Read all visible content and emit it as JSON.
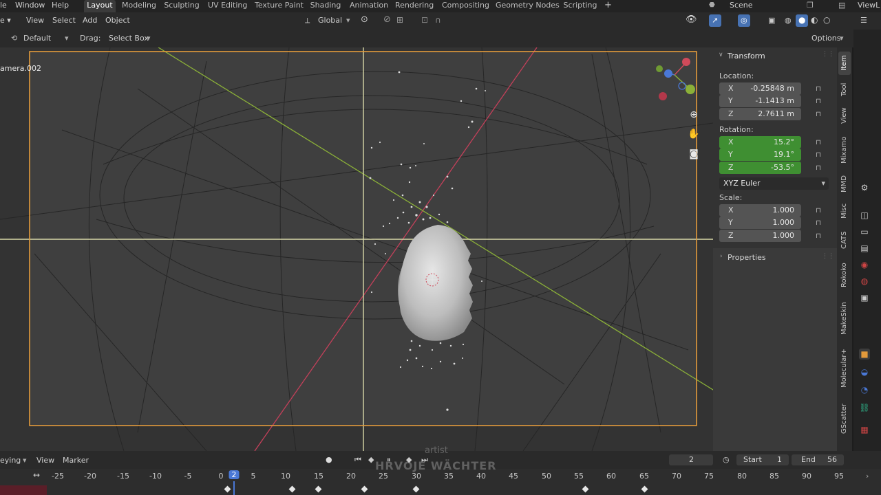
{
  "menu": {
    "file_partial": "le",
    "window": "Window",
    "help": "Help"
  },
  "workspaces": [
    "Layout",
    "Modeling",
    "Sculpting",
    "UV Editing",
    "Texture Paint",
    "Shading",
    "Animation",
    "Rendering",
    "Compositing",
    "Geometry Nodes",
    "Scripting"
  ],
  "top_right": {
    "scene": "Scene",
    "view_layer": "ViewL"
  },
  "header": {
    "view": "View",
    "select": "Select",
    "add": "Add",
    "object": "Object",
    "orientation": "Global",
    "transform_orientation_label": "Default",
    "drag_label": "Drag:",
    "drag_value": "Select Box",
    "options": "Options"
  },
  "viewport": {
    "camera_label": "amera.002"
  },
  "transform": {
    "title": "Transform",
    "location_label": "Location:",
    "location": {
      "x": "-0.25848 m",
      "y": "-1.1413 m",
      "z": "2.7611 m"
    },
    "rotation_label": "Rotation:",
    "rotation": {
      "x": "15.2°",
      "y": "19.1°",
      "z": "-53.5°"
    },
    "rotation_mode": "XYZ Euler",
    "scale_label": "Scale:",
    "scale": {
      "x": "1.000",
      "y": "1.000",
      "z": "1.000"
    },
    "axis_x": "X",
    "axis_y": "Y",
    "axis_z": "Z"
  },
  "properties_panel": {
    "title": "Properties"
  },
  "side_tabs": [
    "Item",
    "Tool",
    "View",
    "Mixamo",
    "MMD",
    "Misc",
    "CATS",
    "Rokoko",
    "MakeSkin",
    "Molecular+",
    "GScatter"
  ],
  "timeline": {
    "keying": "eying",
    "view": "View",
    "marker": "Marker",
    "current_frame": "2",
    "start_label": "Start",
    "start": "1",
    "end_label": "End",
    "end": "56",
    "ruler": [
      "-25",
      "-20",
      "-15",
      "-10",
      "-5",
      "0",
      "2",
      "5",
      "10",
      "15",
      "20",
      "25",
      "30",
      "35",
      "40",
      "45",
      "50",
      "55",
      "60",
      "65",
      "70",
      "75",
      "80",
      "85",
      "90",
      "95"
    ]
  },
  "watermark": {
    "role": "artist",
    "name": "HRVOJE WÄCHTER"
  },
  "colors": {
    "accent": "#4772b3",
    "rotation_green": "#3f8f32",
    "camera_frame": "#e39a3b",
    "x_axis": "#d04a5a",
    "y_axis": "#8fb33a"
  }
}
